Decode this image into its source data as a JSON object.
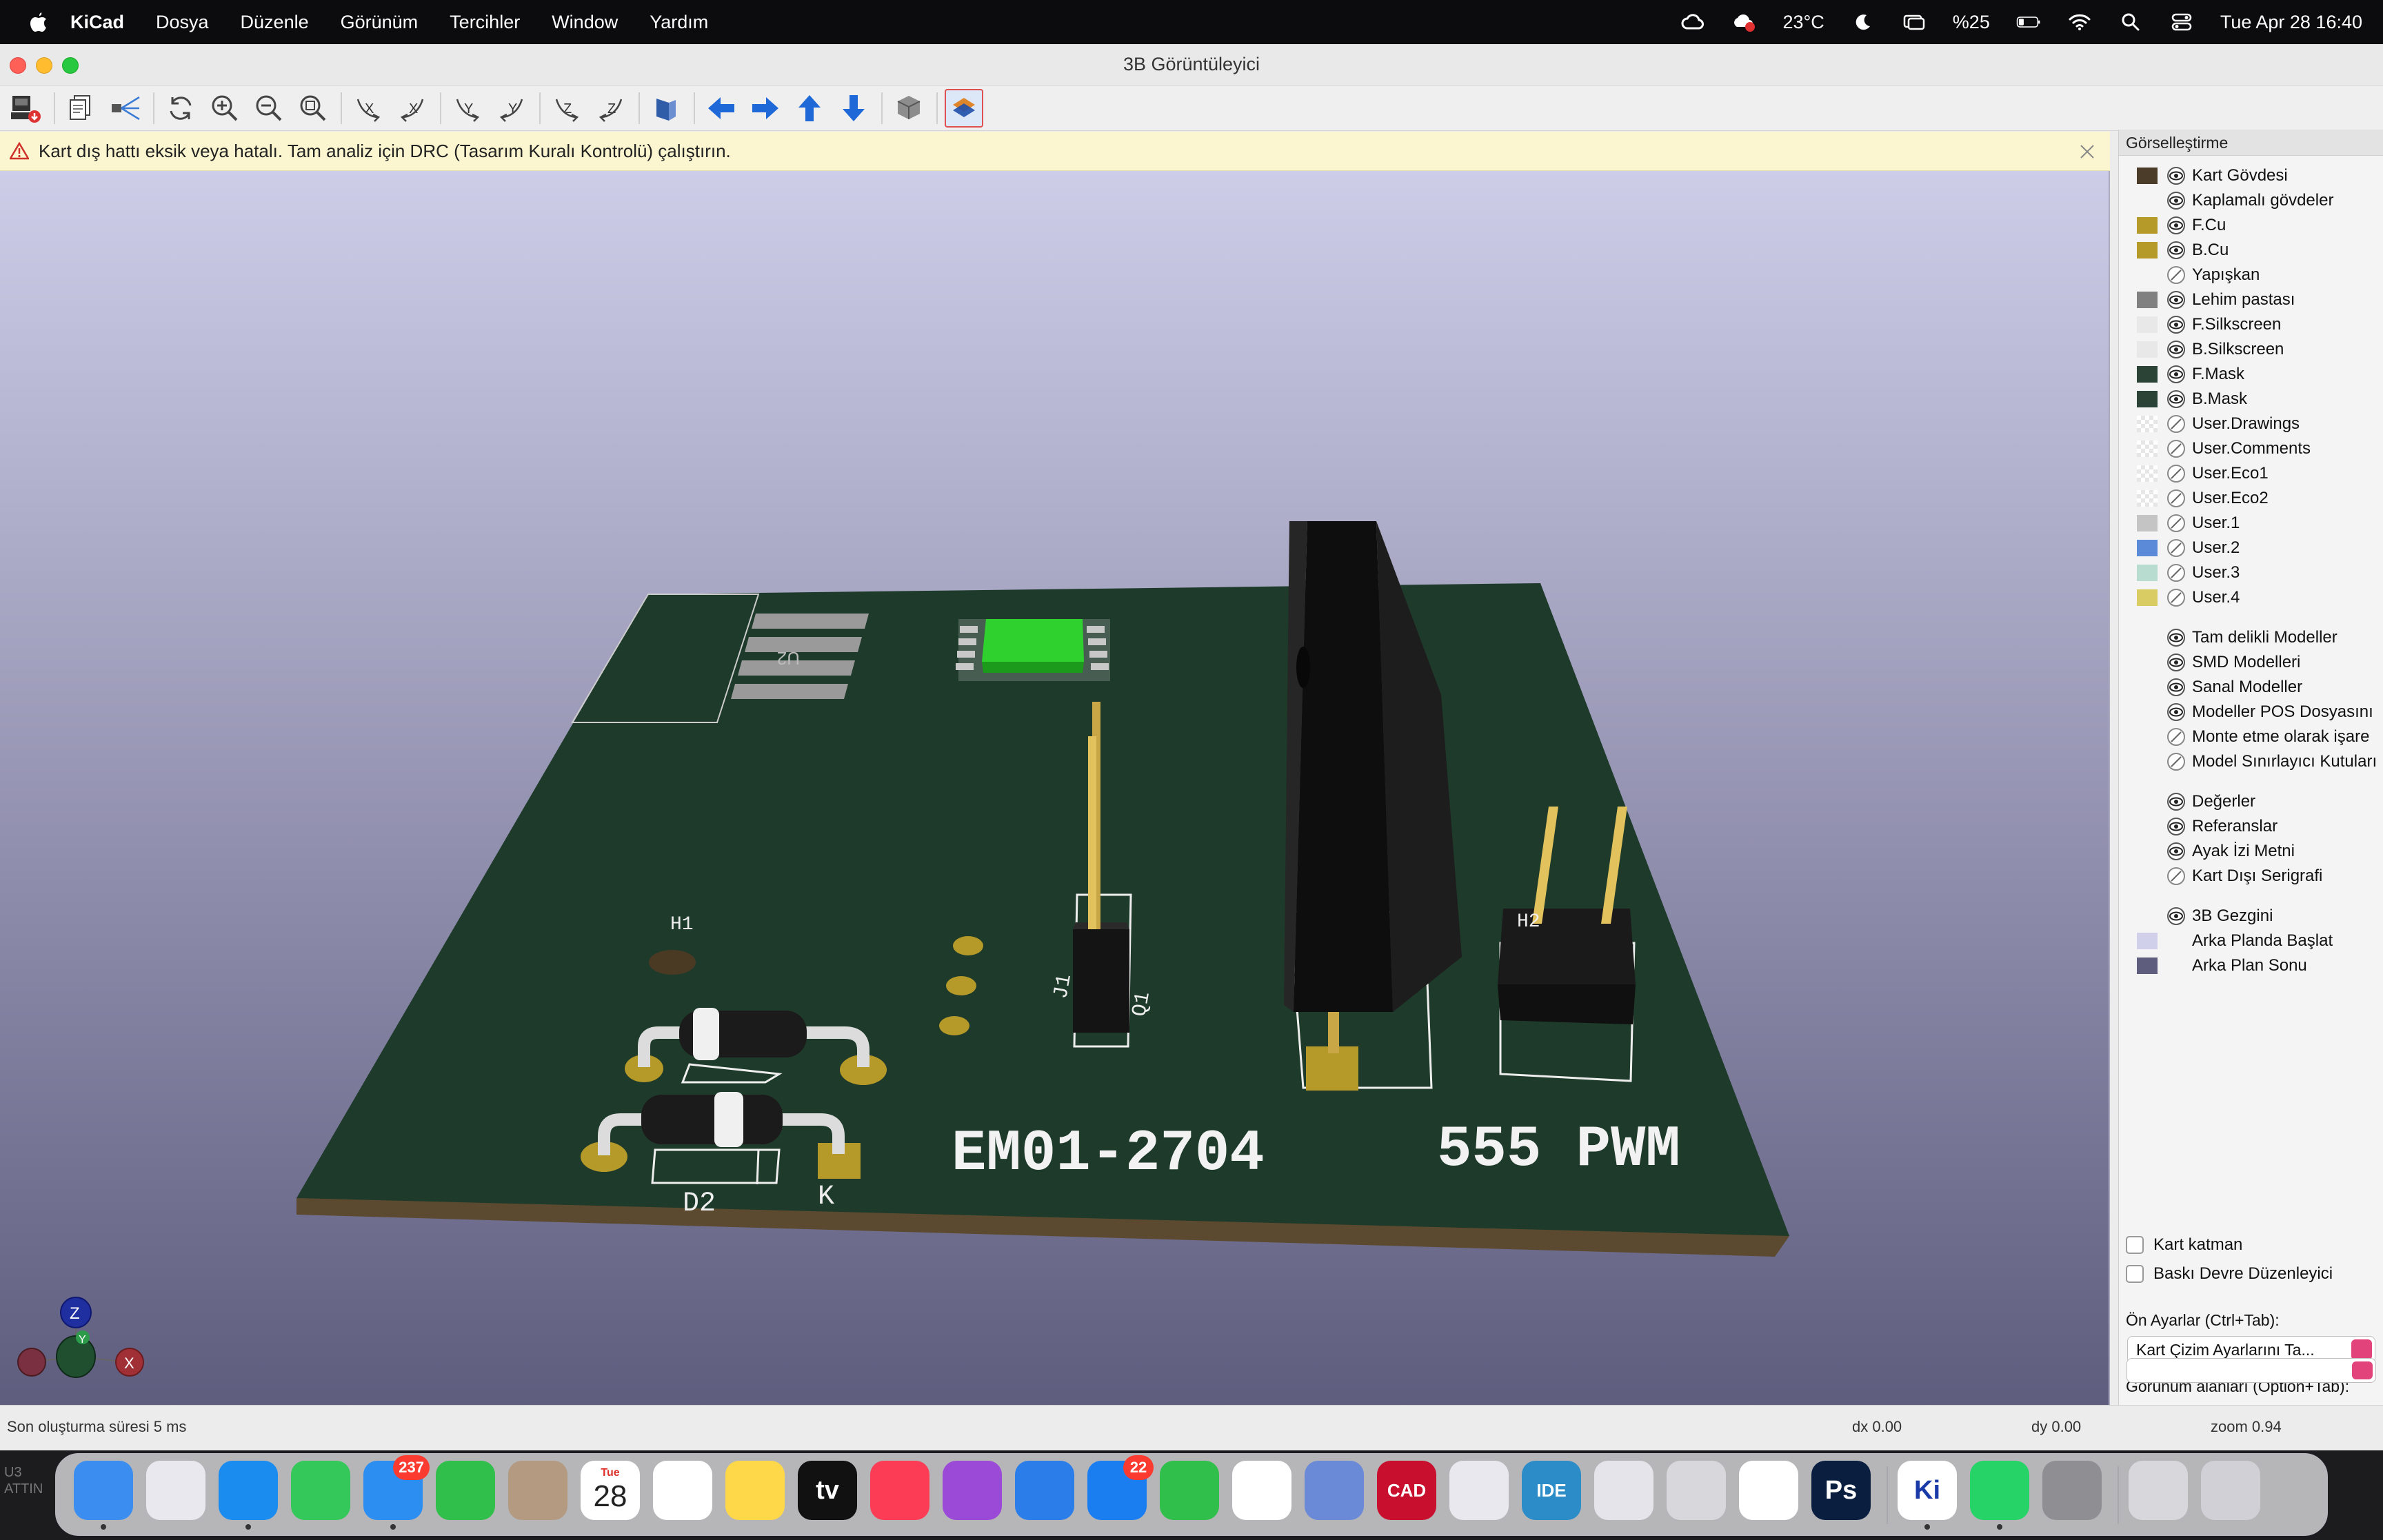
{
  "menubar": {
    "app_name": "KiCad",
    "menus": [
      "Dosya",
      "Düzenle",
      "Görünüm",
      "Tercihler",
      "Window",
      "Yardım"
    ],
    "temperature": "23°C",
    "battery": "%25",
    "datetime": "Tue Apr 28  16:40"
  },
  "window": {
    "title": "3B Görüntüleyici"
  },
  "toolbar": {
    "icons": [
      "export-icon",
      "copy-icon",
      "raytrace-icon",
      "reload-icon",
      "zoom-in-icon",
      "zoom-out-icon",
      "zoom-fit-icon",
      "rotate-x-cw-icon",
      "rotate-x-ccw-icon",
      "rotate-y-cw-icon",
      "rotate-y-ccw-icon",
      "rotate-z-cw-icon",
      "rotate-z-ccw-icon",
      "flip-board-icon",
      "move-left-icon",
      "move-right-icon",
      "move-up-icon",
      "move-down-icon",
      "ortho-icon",
      "layers-toggle-icon"
    ]
  },
  "infobar": {
    "message": "Kart dış hattı eksik veya hatalı. Tam analiz için DRC (Tasarım Kuralı Kontrolü) çalıştırın."
  },
  "board": {
    "text_left": "EM01-2704",
    "text_right": "555 PWM",
    "labels": {
      "h1": "H1",
      "h2": "H2",
      "d2": "D2",
      "k": "K",
      "j1": "J1",
      "q1": "Q1",
      "u2": "U2"
    },
    "axis": {
      "z": "Z",
      "y": "Y",
      "x": "X"
    },
    "colors": {
      "mask": "#1e3a2a",
      "copper": "#b59a2a",
      "silk": "#f2f2f2",
      "background_top": "#cdcde8",
      "background_bottom": "#5f5d7e"
    }
  },
  "panel": {
    "title": "Görselleştirme",
    "layers": [
      {
        "label": "Kart Gövdesi",
        "color": "#4a3c28",
        "visible": true
      },
      {
        "label": "Kaplamalı gövdeler",
        "color": "",
        "visible": true
      },
      {
        "label": "F.Cu",
        "color": "#b59a2a",
        "visible": true
      },
      {
        "label": "B.Cu",
        "color": "#b59a2a",
        "visible": true
      },
      {
        "label": "Yapışkan",
        "color": "",
        "visible": false
      },
      {
        "label": "Lehim pastası",
        "color": "#808080",
        "visible": true
      },
      {
        "label": "F.Silkscreen",
        "color": "#e8e8e8",
        "visible": true
      },
      {
        "label": "B.Silkscreen",
        "color": "#e8e8e8",
        "visible": true
      },
      {
        "label": "F.Mask",
        "color": "#2b4236",
        "visible": true
      },
      {
        "label": "B.Mask",
        "color": "#2b4236",
        "visible": true
      },
      {
        "label": "User.Drawings",
        "color": "checker",
        "visible": false
      },
      {
        "label": "User.Comments",
        "color": "checker",
        "visible": false
      },
      {
        "label": "User.Eco1",
        "color": "checker",
        "visible": false
      },
      {
        "label": "User.Eco2",
        "color": "checker",
        "visible": false
      },
      {
        "label": "User.1",
        "color": "#c4c4c4",
        "visible": false
      },
      {
        "label": "User.2",
        "color": "#5b8bd8",
        "visible": false
      },
      {
        "label": "User.3",
        "color": "#b8dcd0",
        "visible": false
      },
      {
        "label": "User.4",
        "color": "#d8cc62",
        "visible": false
      }
    ],
    "models": [
      {
        "label": "Tam delikli Modeller",
        "visible": true
      },
      {
        "label": "SMD Modelleri",
        "visible": true
      },
      {
        "label": "Sanal Modeller",
        "visible": true
      },
      {
        "label": "Modeller POS Dosyasını",
        "visible": true
      },
      {
        "label": "Monte etme olarak işare",
        "visible": false
      },
      {
        "label": "Model Sınırlayıcı Kutuları",
        "visible": false
      }
    ],
    "texts": [
      {
        "label": "Değerler",
        "visible": true
      },
      {
        "label": "Referanslar",
        "visible": true
      },
      {
        "label": "Ayak İzi Metni",
        "visible": true
      },
      {
        "label": "Kart Dışı Serigrafi",
        "visible": false
      }
    ],
    "misc": [
      {
        "label": "3B Gezgini",
        "color": "",
        "visible": true
      },
      {
        "label": "Arka Planda Başlat",
        "color": "#d0d0ea",
        "visible": null
      },
      {
        "label": "Arka Plan Sonu",
        "color": "#5f5d7e",
        "visible": null
      }
    ],
    "checkbox_board_layer": "Kart katman",
    "checkbox_pcb_editor": "Baskı Devre Düzenleyici",
    "presets_label": "Ön Ayarlar (Ctrl+Tab):",
    "presets_value": "Kart Çizim Ayarlarını Ta...",
    "viewports_label": "Görünüm alanları (Option+Tab):",
    "viewports_value": ""
  },
  "statusbar": {
    "render_time": "Son oluşturma süresi 5 ms",
    "dx": "dx 0.00",
    "dy": "dy 0.00",
    "zoom": "zoom 0.94"
  },
  "behind_window": {
    "line1": "U3",
    "line2": "ATTIN"
  },
  "dock": {
    "apps": [
      {
        "name": "finder-icon",
        "color": "#3b8ef0"
      },
      {
        "name": "launchpad-icon",
        "color": "#e8e8ee"
      },
      {
        "name": "safari-icon",
        "color": "#1a8cf0"
      },
      {
        "name": "messages-icon",
        "color": "#34c759"
      },
      {
        "name": "mail-icon",
        "color": "#2c8ef0",
        "badge": "237"
      },
      {
        "name": "facetime-icon",
        "color": "#2fbf4a"
      },
      {
        "name": "contacts-icon",
        "color": "#b39a80"
      },
      {
        "name": "calendar-icon",
        "color": "#ffffff",
        "day": "Tue",
        "date": "28"
      },
      {
        "name": "reminders-icon",
        "color": "#ffffff"
      },
      {
        "name": "notes-icon",
        "color": "#ffd84a"
      },
      {
        "name": "apple-tv-icon",
        "color": "#111111",
        "text": "tv"
      },
      {
        "name": "music-icon",
        "color": "#fb3c54"
      },
      {
        "name": "podcasts-icon",
        "color": "#9b4ad8"
      },
      {
        "name": "keynote-icon",
        "color": "#2b7de9"
      },
      {
        "name": "app-store-icon",
        "color": "#1a7ef0",
        "badge": "22"
      },
      {
        "name": "numbers-icon",
        "color": "#2fbf4a"
      },
      {
        "name": "chrome-icon",
        "color": "#ffffff"
      },
      {
        "name": "simulator-icon",
        "color": "#6a8ad8"
      },
      {
        "name": "autocad-icon",
        "color": "#c8102e",
        "text": "CAD"
      },
      {
        "name": "matlab-icon",
        "color": "#e8e8ee"
      },
      {
        "name": "arduino-ide-icon",
        "color": "#2b8cc8",
        "text": "IDE"
      },
      {
        "name": "visual-studio-icon",
        "color": "#e4e4ea"
      },
      {
        "name": "installer-icon",
        "color": "#d8d8dc"
      },
      {
        "name": "chatgpt-icon",
        "color": "#ffffff"
      },
      {
        "name": "photoshop-icon",
        "color": "#0a1e40",
        "text": "Ps"
      },
      {
        "name": "kicad-icon",
        "color": "#ffffff",
        "text": "Ki"
      },
      {
        "name": "whatsapp-icon",
        "color": "#25d366"
      },
      {
        "name": "system-settings-icon",
        "color": "#8e8e93"
      },
      {
        "name": "downloads-icon",
        "color": "#d8d8dc"
      },
      {
        "name": "trash-icon",
        "color": "#d0d0d6"
      }
    ]
  }
}
